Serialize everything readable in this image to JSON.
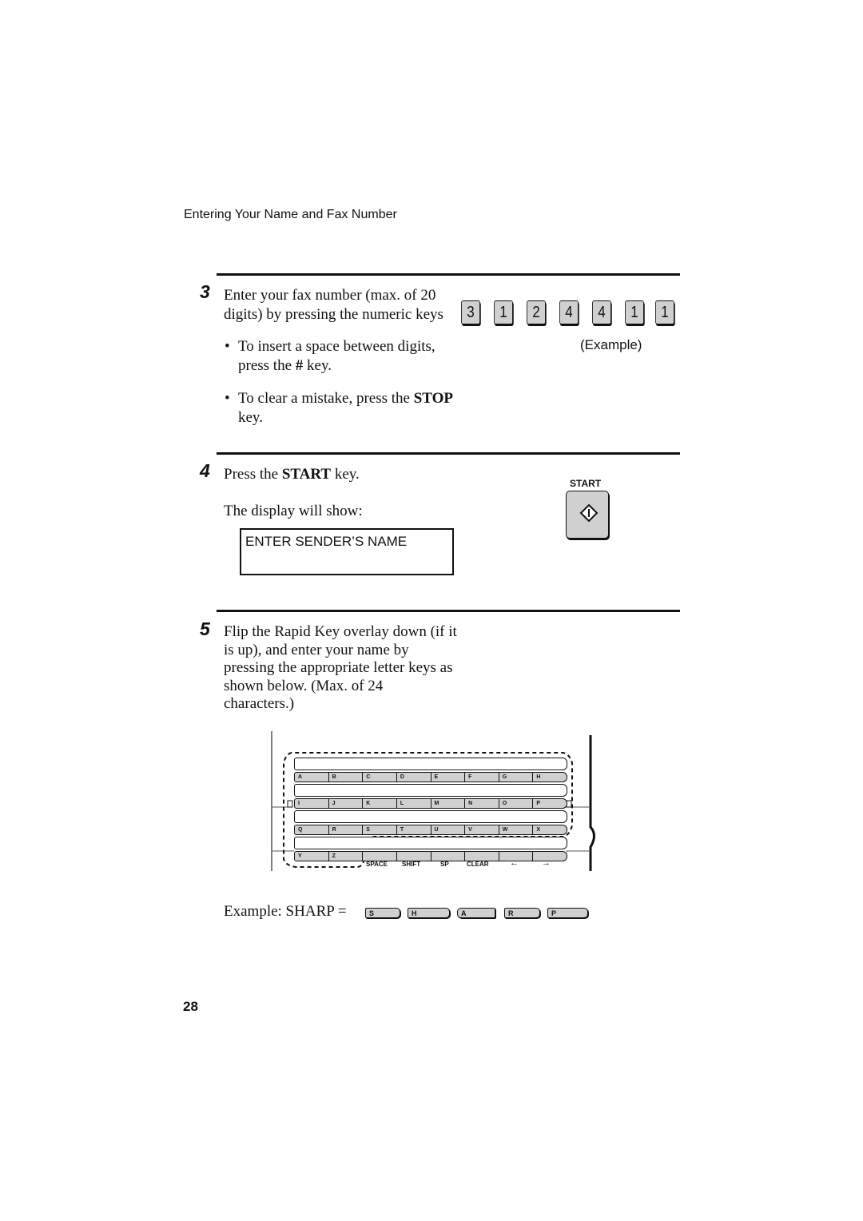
{
  "header": {
    "title": "Entering Your Name and Fax Number"
  },
  "step3": {
    "number": "3",
    "line1": "Enter your fax number (max. of 20",
    "line2": "digits) by pressing the numeric keys",
    "example_keys": [
      "3",
      "1",
      "2",
      "4",
      "4",
      "1",
      "1"
    ],
    "example_label": "(Example)",
    "bullet1": {
      "line1": "To insert  a space between digits,",
      "line2_pre": "press the ",
      "line2_key": "#",
      "line2_post": " key."
    },
    "bullet2": {
      "line1_pre": "To clear a mistake, press the ",
      "line1_key": "STOP",
      "line2": "key."
    },
    "bullet_glyph": "•"
  },
  "step4": {
    "number": "4",
    "line1_pre": "Press the ",
    "line1_key": "START",
    "line1_post": " key.",
    "line2": "The display will show:",
    "display_text": "ENTER SENDER’S NAME",
    "start_key_label": "START",
    "start_key_icon": "start-diamond-icon"
  },
  "step5": {
    "number": "5",
    "lines": [
      "Flip the Rapid Key overlay down (if it",
      "is up), and enter your name by",
      "pressing the appropriate letter keys as",
      "shown below. (Max. of 24",
      "characters.)"
    ],
    "keyboard": {
      "rows": [
        [
          "A",
          "B",
          "C",
          "D",
          "E",
          "F",
          "G",
          "H"
        ],
        [
          "I",
          "J",
          "K",
          "L",
          "M",
          "N",
          "O",
          "P"
        ],
        [
          "Q",
          "R",
          "S",
          "T",
          "U",
          "V",
          "W",
          "X"
        ],
        [
          "Y",
          "Z",
          "",
          "",
          "",
          "",
          "",
          ""
        ]
      ],
      "function_labels": [
        "SPACE",
        "SHIFT",
        "SP",
        "CLEAR",
        "←",
        "→"
      ]
    },
    "example_label": "Example: SHARP =",
    "example_keys": [
      "S",
      "H",
      "A",
      "R",
      "P"
    ]
  },
  "footer": {
    "page_number": "28"
  }
}
